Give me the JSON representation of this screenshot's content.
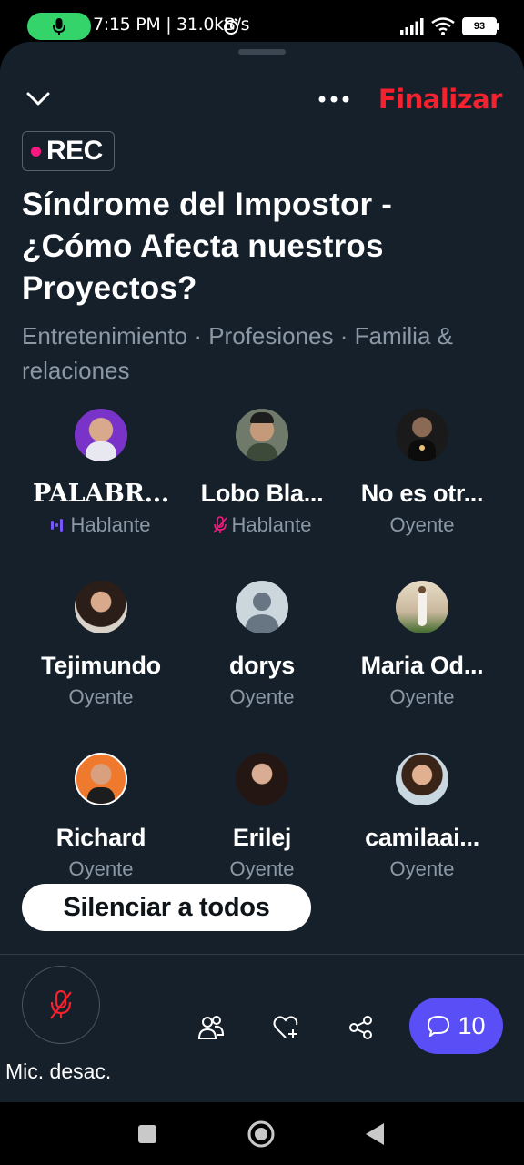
{
  "status_bar": {
    "time_speed": "7:15 PM | 31.0kB/s",
    "battery": "93"
  },
  "header": {
    "finalize_label": "Finalizar",
    "rec_label": "REC"
  },
  "space": {
    "title": "Síndrome del Impostor - ¿Cómo Afecta nuestros Proyectos?",
    "topics": "Entretenimiento · Profesiones · Familia & relaciones"
  },
  "participants": [
    {
      "name": "PALABR...",
      "role": "Hablante"
    },
    {
      "name": "Lobo Bla...",
      "role": "Hablante"
    },
    {
      "name": "No es otr...",
      "role": "Oyente"
    },
    {
      "name": "Tejimundo",
      "role": "Oyente"
    },
    {
      "name": "dorys",
      "role": "Oyente"
    },
    {
      "name": "Maria Od...",
      "role": "Oyente"
    },
    {
      "name": "Richard",
      "role": "Oyente"
    },
    {
      "name": "Erilej",
      "role": "Oyente"
    },
    {
      "name": "camilaai...",
      "role": "Oyente"
    }
  ],
  "actions": {
    "mute_all_label": "Silenciar a todos",
    "mic_label": "Mic. desac.",
    "comments_count": "10"
  },
  "colors": {
    "background": "#15202b",
    "accent_red": "#f4212e",
    "rec_pink": "#f91880",
    "comments_purple": "#5a4ef6",
    "speaker_indicator": "#7856ff",
    "muted_pink": "#f91880",
    "muted_text": "#8b98a5"
  }
}
